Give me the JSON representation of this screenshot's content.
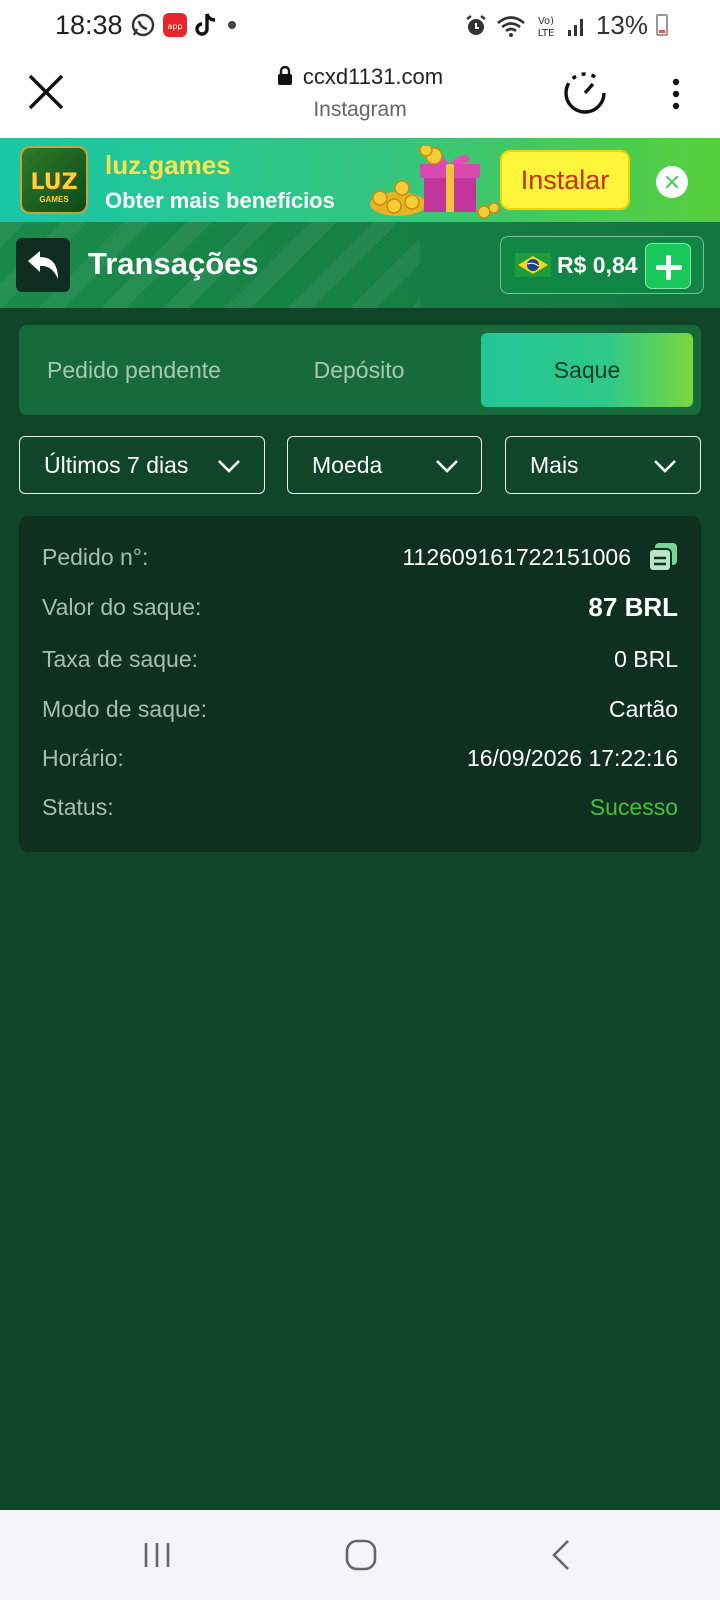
{
  "status_bar": {
    "time": "18:38",
    "battery": "13%",
    "app_icons": [
      "whatsapp-icon",
      "app-icon",
      "tiktok-icon",
      "dot-icon"
    ],
    "system_icons": [
      "alarm-icon",
      "wifi-icon",
      "volte-icon",
      "signal-icon",
      "battery-icon"
    ]
  },
  "browser": {
    "url": "ccxd1131.com",
    "source": "Instagram"
  },
  "banner": {
    "logo_text": "LUZ",
    "logo_sub": "GAMES",
    "title": "luz.games",
    "subtitle": "Obter mais benefícios",
    "install_label": "Instalar"
  },
  "header": {
    "title": "Transações",
    "balance": "R$ 0,84"
  },
  "tabs": [
    {
      "label": "Pedido pendente",
      "active": false
    },
    {
      "label": "Depósito",
      "active": false
    },
    {
      "label": "Saque",
      "active": true
    }
  ],
  "filters": {
    "period": "Últimos 7 dias",
    "currency": "Moeda",
    "more": "Mais"
  },
  "transaction": {
    "order_label": "Pedido n°:",
    "order_value": "112609161722151006",
    "amount_label": "Valor do saque:",
    "amount_value": "87 BRL",
    "fee_label": "Taxa de saque:",
    "fee_value": "0 BRL",
    "mode_label": "Modo de saque:",
    "mode_value": "Cartão",
    "time_label": "Horário:",
    "time_value": "16/09/2026 17:22:16",
    "status_label": "Status:",
    "status_value": "Sucesso"
  },
  "colors": {
    "page_bg": "#10452a",
    "header_bg": "#1a8a4a",
    "card_bg": "#0f301f",
    "success": "#46c23a",
    "install_button": "#fff53a"
  }
}
